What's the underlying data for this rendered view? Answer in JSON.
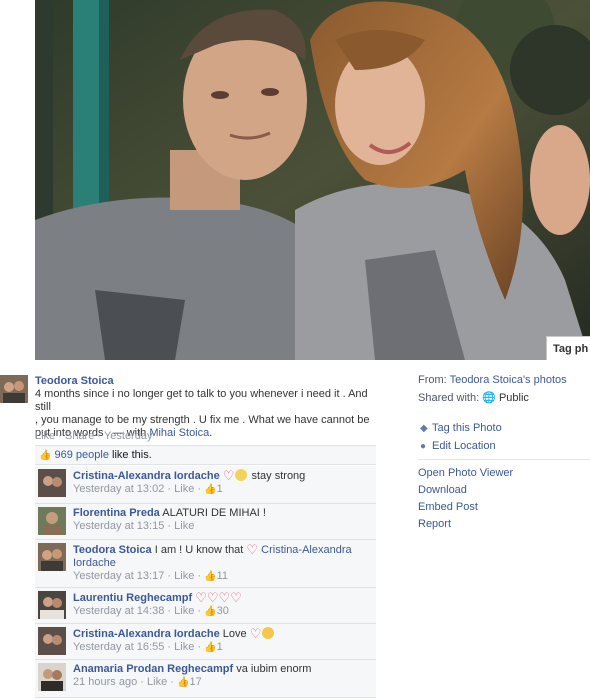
{
  "photo": {
    "tag_button": "Tag ph"
  },
  "post": {
    "author": "Teodora Stoica",
    "caption_line1": "4 months since i no longer get to talk to you whenever i need it . And still",
    "caption_line2": ", you manage to be my strength . U fix me . What we have cannot be",
    "caption_line3": "put into words . — with ",
    "caption_tag": "Mihai Stoica",
    "caption_end": ".",
    "action_like": "Like",
    "action_share": "Share",
    "timestamp": "Yesterday",
    "likes_count_text": "969 people",
    "likes_suffix": " like this."
  },
  "sidebar": {
    "from_label": "From: ",
    "from_value": "Teodora Stoica's photos",
    "shared_label": "Shared with: ",
    "shared_value": "Public",
    "tag_photo": "Tag this Photo",
    "edit_location": "Edit Location",
    "links": [
      "Open Photo Viewer",
      "Download",
      "Embed Post",
      "Report"
    ]
  },
  "comments": [
    {
      "name": "Cristina-Alexandra Iordache",
      "text": " stay strong",
      "time": "Yesterday at 13:02",
      "like": "Like",
      "likes": "1"
    },
    {
      "name": "Florentina Preda",
      "text": " ALATURI DE MIHAI !",
      "time": "Yesterday at 13:15",
      "like": "Like",
      "likes": ""
    },
    {
      "name": "Teodora Stoica",
      "text": " I am ! U know that ",
      "text_tag": "Cristina-Alexandra",
      "text_tag2": "Iordache",
      "time": "Yesterday at 13:17",
      "like": "Like",
      "likes": "11"
    },
    {
      "name": "Laurentiu Reghecampf",
      "text": "",
      "time": "Yesterday at 14:38",
      "like": "Like",
      "likes": "30"
    },
    {
      "name": "Cristina-Alexandra Iordache",
      "text": " Love",
      "time": "Yesterday at 16:55",
      "like": "Like",
      "likes": "1"
    },
    {
      "name": "Anamaria Prodan Reghecampf",
      "text": " va iubim enorm",
      "time": "21 hours ago",
      "like": "Like",
      "likes": "17"
    }
  ],
  "colors": {
    "link": "#3b5998",
    "meta": "#9197a3",
    "comment_bg": "#f6f7f9",
    "heart": "#e45a6b"
  }
}
